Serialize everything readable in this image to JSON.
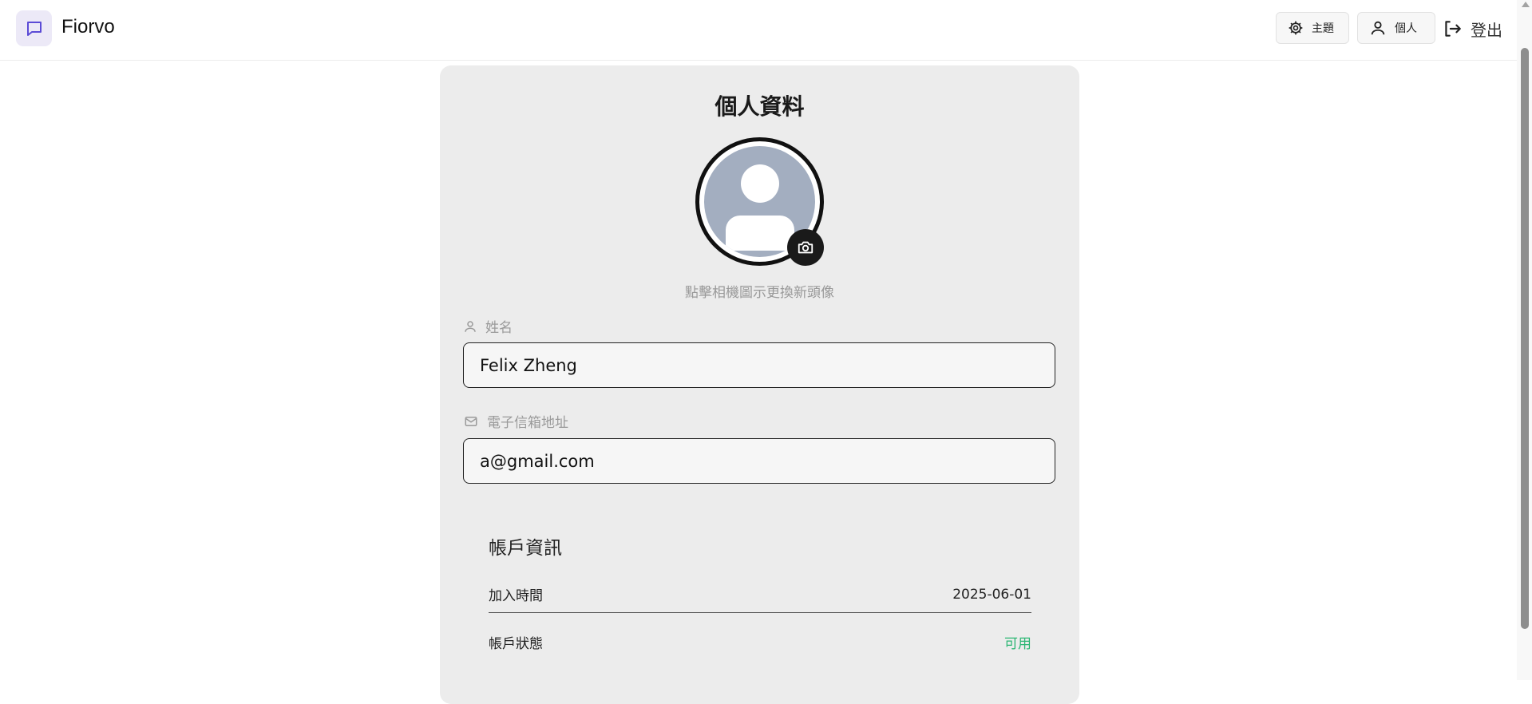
{
  "app": {
    "brand": "Fiorvo",
    "logo_icon": "chat-bubble-icon",
    "accent_color": "#5b4bd6"
  },
  "header": {
    "theme_label": "主題",
    "profile_label": "個人",
    "logout_label": "登出"
  },
  "profile": {
    "title": "個人資料",
    "avatar_hint": "點擊相機圖示更換新頭像",
    "name_label": "姓名",
    "name_value": "Felix Zheng",
    "email_label": "電子信箱地址",
    "email_value": "a@gmail.com"
  },
  "account": {
    "section_title": "帳戶資訊",
    "join_label": "加入時間",
    "join_value": "2025-06-01",
    "status_label": "帳戶狀態",
    "status_value": "可用",
    "status_color": "#2bb673"
  }
}
